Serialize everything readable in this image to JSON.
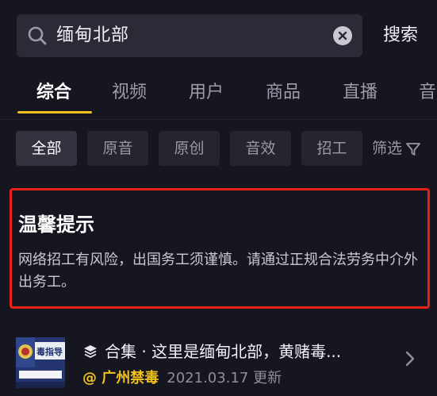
{
  "search": {
    "query": "缅甸北部",
    "button_label": "搜索"
  },
  "tabs": [
    "综合",
    "视频",
    "用户",
    "商品",
    "直播",
    "音"
  ],
  "chips": [
    "全部",
    "原音",
    "原创",
    "音效",
    "招工"
  ],
  "filter_label": "筛选",
  "tip": {
    "title": "温馨提示",
    "body": "网络招工有风险，出国务工须谨慎。请通过正规合法劳务中介外出务工。"
  },
  "result": {
    "title": "合集 · 这里是缅甸北部，黄赌毒...",
    "author": "@ 广州禁毒",
    "date": "2021.03.17 更新",
    "thumb_text": "毒指导"
  },
  "colors": {
    "accent": "#f1c21b",
    "warning_border": "#e62218",
    "background": "#161621"
  }
}
